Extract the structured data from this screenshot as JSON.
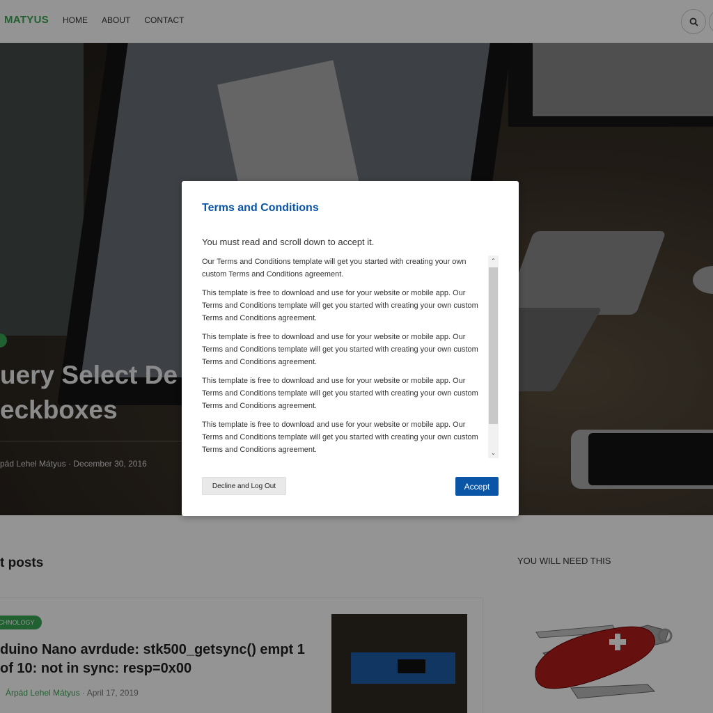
{
  "header": {
    "brand": "MATYUS",
    "nav": [
      {
        "label": "HOME"
      },
      {
        "label": "ABOUT"
      },
      {
        "label": "CONTACT"
      }
    ]
  },
  "hero": {
    "title_line1": "uery Select De",
    "title_line2": "eckboxes",
    "meta": "pád Lehel Mátyus · December 30, 2016"
  },
  "content": {
    "posts_heading": "t posts",
    "widget_heading": "YOU WILL NEED THIS",
    "post": {
      "category": "CHNOLOGY",
      "title": "duino Nano avrdude: stk500_getsync() empt 1 of 10: not in sync: resp=0x00",
      "author": "Árpád Lehel Mátyus",
      "date": "· April 17, 2019"
    }
  },
  "modal": {
    "title": "Terms and Conditions",
    "subtitle": "You must read and scroll down to accept it.",
    "paragraphs": [
      "Our Terms and Conditions template will get you started with creating your own custom Terms and Conditions agreement.",
      "This template is free to download and use for your website or mobile app. Our Terms and Conditions template will get you started with creating your own custom Terms and Conditions agreement.",
      "This template is free to download and use for your website or mobile app. Our Terms and Conditions template will get you started with creating your own custom Terms and Conditions agreement.",
      "This template is free to download and use for your website or mobile app. Our Terms and Conditions template will get you started with creating your own custom Terms and Conditions agreement.",
      "This template is free to download and use for your website or mobile app. Our Terms and Conditions template will get you started with creating your own custom Terms and Conditions agreement."
    ],
    "decline_label": "Decline and Log Out",
    "accept_label": "Accept",
    "scroll_up_glyph": "⌃",
    "scroll_down_glyph": "⌄"
  },
  "colors": {
    "brand_green": "#3aa655",
    "modal_blue": "#0b55a7"
  },
  "icons": {
    "search": "search-icon"
  }
}
